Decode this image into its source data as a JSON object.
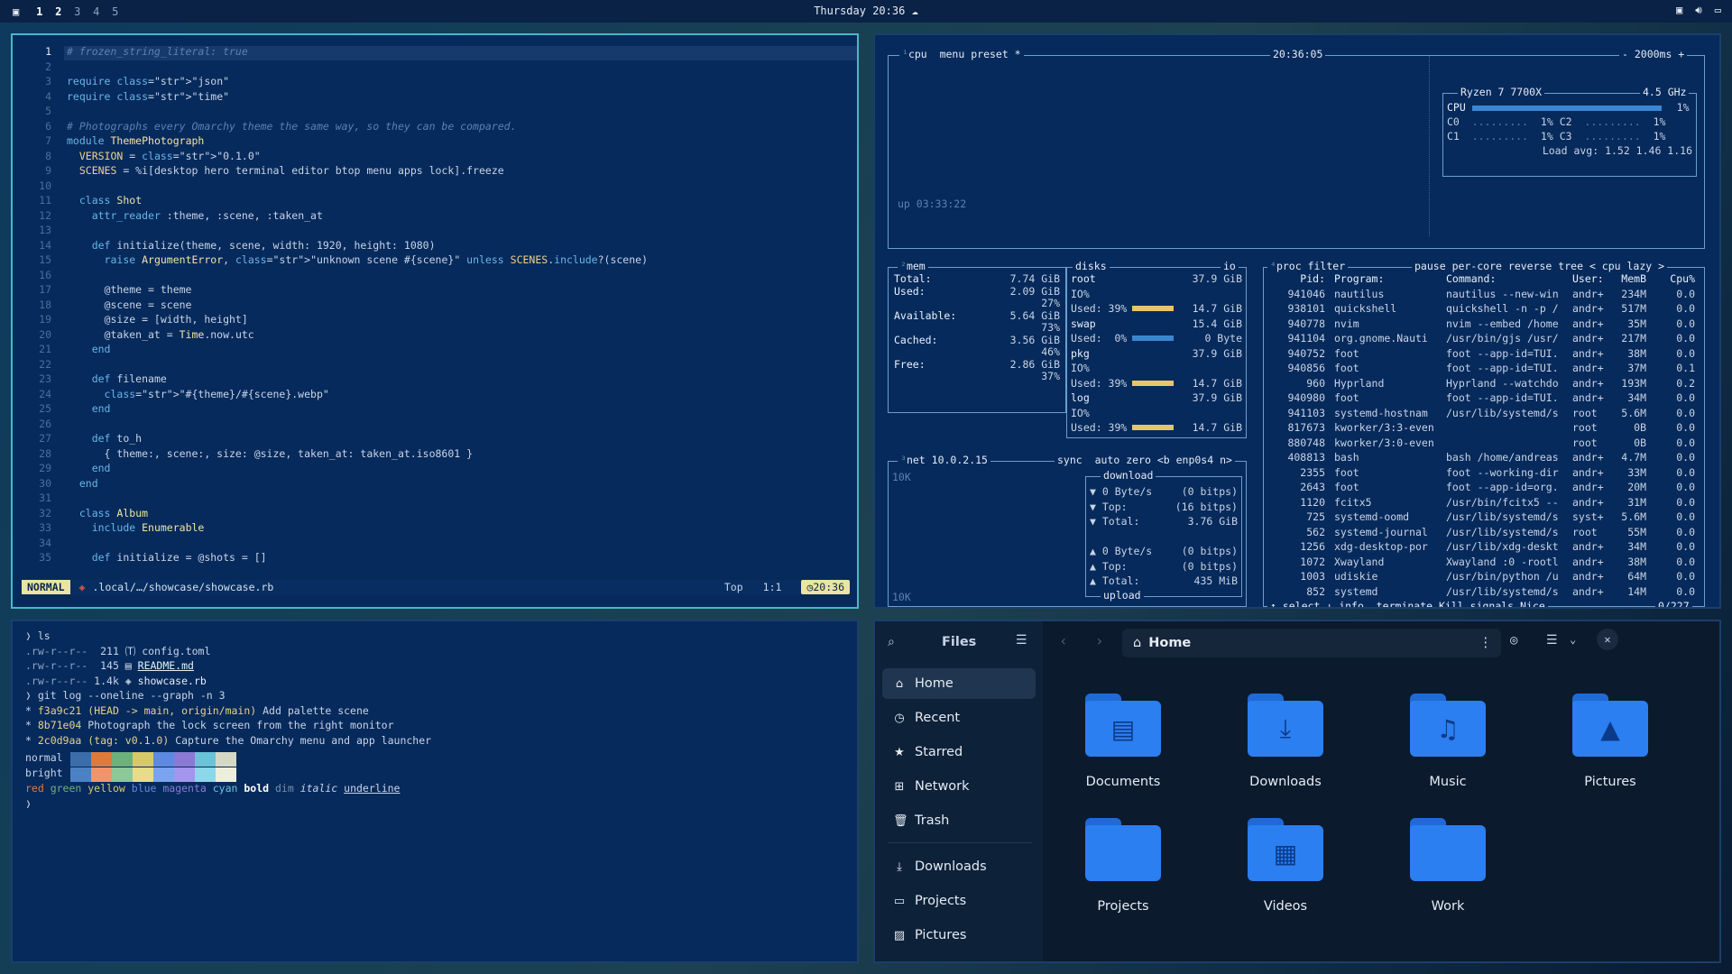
{
  "topbar": {
    "workspaces": [
      "1",
      "2",
      "3",
      "4",
      "5"
    ],
    "clock": "Thursday 20:36"
  },
  "nvim": {
    "lines": [
      {
        "n": "1",
        "t": "# frozen_string_literal: true"
      },
      {
        "n": "2",
        "t": ""
      },
      {
        "n": "3",
        "t": "require \"json\""
      },
      {
        "n": "4",
        "t": "require \"time\""
      },
      {
        "n": "5",
        "t": ""
      },
      {
        "n": "6",
        "t": "# Photographs every Omarchy theme the same way, so they can be compared."
      },
      {
        "n": "7",
        "t": "module ThemePhotograph"
      },
      {
        "n": "8",
        "t": "  VERSION = \"0.1.0\""
      },
      {
        "n": "9",
        "t": "  SCENES = %i[desktop hero terminal editor btop menu apps lock].freeze"
      },
      {
        "n": "10",
        "t": ""
      },
      {
        "n": "11",
        "t": "  class Shot"
      },
      {
        "n": "12",
        "t": "    attr_reader :theme, :scene, :taken_at"
      },
      {
        "n": "13",
        "t": ""
      },
      {
        "n": "14",
        "t": "    def initialize(theme, scene, width: 1920, height: 1080)"
      },
      {
        "n": "15",
        "t": "      raise ArgumentError, \"unknown scene #{scene}\" unless SCENES.include?(scene)"
      },
      {
        "n": "16",
        "t": ""
      },
      {
        "n": "17",
        "t": "      @theme = theme"
      },
      {
        "n": "18",
        "t": "      @scene = scene"
      },
      {
        "n": "19",
        "t": "      @size = [width, height]"
      },
      {
        "n": "20",
        "t": "      @taken_at = Time.now.utc"
      },
      {
        "n": "21",
        "t": "    end"
      },
      {
        "n": "22",
        "t": ""
      },
      {
        "n": "23",
        "t": "    def filename"
      },
      {
        "n": "24",
        "t": "      \"#{theme}/#{scene}.webp\""
      },
      {
        "n": "25",
        "t": "    end"
      },
      {
        "n": "26",
        "t": ""
      },
      {
        "n": "27",
        "t": "    def to_h"
      },
      {
        "n": "28",
        "t": "      { theme:, scene:, size: @size, taken_at: taken_at.iso8601 }"
      },
      {
        "n": "29",
        "t": "    end"
      },
      {
        "n": "30",
        "t": "  end"
      },
      {
        "n": "31",
        "t": ""
      },
      {
        "n": "32",
        "t": "  class Album"
      },
      {
        "n": "33",
        "t": "    include Enumerable"
      },
      {
        "n": "34",
        "t": ""
      },
      {
        "n": "35",
        "t": "    def initialize = @shots = []"
      }
    ],
    "status": {
      "mode": "NORMAL",
      "path": ".local/…/showcase/showcase.rb",
      "pos": "Top",
      "cursor": "1:1",
      "time": "20:36"
    }
  },
  "btop": {
    "cpu_tab": "cpu",
    "menu_tab": "menu",
    "preset_tab": "preset *",
    "time": "20:36:05",
    "interval": "- 2000ms +",
    "uptime": "up 03:33:22",
    "cpu_model": "Ryzen 7 7700X",
    "cpu_freq": "4.5 GHz",
    "cpu_rows": [
      {
        "a": "CPU",
        "av": "1%"
      },
      {
        "a": "C0",
        "av": "1%",
        "b": "C2",
        "bv": "1%"
      },
      {
        "a": "C1",
        "av": "1%",
        "b": "C3",
        "bv": "1%"
      }
    ],
    "load": "Load avg: 1.52 1.46 1.16",
    "mem": {
      "title": "mem",
      "rows": [
        {
          "l": "Total:",
          "v": "7.74 GiB"
        },
        {
          "l": "Used:",
          "v": "2.09 GiB"
        },
        {
          "l": "",
          "v": "27%"
        },
        {
          "l": "Available:",
          "v": "5.64 GiB"
        },
        {
          "l": "",
          "v": "73%"
        },
        {
          "l": "Cached:",
          "v": "3.56 GiB"
        },
        {
          "l": "",
          "v": "46%"
        },
        {
          "l": "Free:",
          "v": "2.86 GiB"
        },
        {
          "l": "",
          "v": "37%"
        }
      ]
    },
    "disks": {
      "title": "disks",
      "io": "io",
      "rows": [
        {
          "l": "root",
          "v": "37.9 GiB",
          "t": "h"
        },
        {
          "l": "IO%",
          "v": "",
          "t": "p"
        },
        {
          "l": "Used: 39%",
          "v": "14.7 GiB",
          "t": "u"
        },
        {
          "l": "swap",
          "v": "15.4 GiB",
          "t": "h"
        },
        {
          "l": "Used:  0%",
          "v": "0 Byte",
          "t": "u0"
        },
        {
          "l": "pkg",
          "v": "37.9 GiB",
          "t": "h"
        },
        {
          "l": "IO%",
          "v": "",
          "t": "p"
        },
        {
          "l": "Used: 39%",
          "v": "14.7 GiB",
          "t": "u"
        },
        {
          "l": "log",
          "v": "37.9 GiB",
          "t": "h"
        },
        {
          "l": "IO%",
          "v": "",
          "t": "p"
        },
        {
          "l": "Used: 39%",
          "v": "14.7 GiB",
          "t": "u"
        }
      ]
    },
    "net": {
      "title": "net",
      "ip": "10.0.2.15",
      "sync": "sync",
      "auto": "auto",
      "zero": "zero",
      "iface": "<b enp0s4 n>",
      "scale_top": "10K",
      "scale_bot": "10K",
      "download": "download",
      "upload": "upload",
      "rows": [
        {
          "l": "▼ 0 Byte/s",
          "v": "(0 bitps)"
        },
        {
          "l": "▼ Top:",
          "v": "(16 bitps)"
        },
        {
          "l": "▼ Total:",
          "v": "3.76 GiB"
        },
        {
          "l": "",
          "v": ""
        },
        {
          "l": "▲ 0 Byte/s",
          "v": "(0 bitps)"
        },
        {
          "l": "▲ Top:",
          "v": "(0 bitps)"
        },
        {
          "l": "▲ Total:",
          "v": "435 MiB"
        }
      ]
    },
    "proc": {
      "title": "proc",
      "filter": "filter",
      "pause": "pause",
      "percore": "per-core",
      "reverse": "reverse",
      "tree": "tree",
      "sort": "< cpu lazy >",
      "header": {
        "pid": "Pid:",
        "prog": "Program:",
        "cmd": "Command:",
        "user": "User:",
        "mem": "MemB",
        "cpu": "Cpu%"
      },
      "rows": [
        [
          "941046",
          "nautilus",
          "nautilus --new-win",
          "andr+",
          "234M",
          "0.0"
        ],
        [
          "938101",
          "quickshell",
          "quickshell -n -p /",
          "andr+",
          "517M",
          "0.0"
        ],
        [
          "940778",
          "nvim",
          "nvim --embed /home",
          "andr+",
          "35M",
          "0.0"
        ],
        [
          "941104",
          "org.gnome.Nauti",
          "/usr/bin/gjs /usr/",
          "andr+",
          "217M",
          "0.0"
        ],
        [
          "940752",
          "foot",
          "foot --app-id=TUI.",
          "andr+",
          "38M",
          "0.0"
        ],
        [
          "940856",
          "foot",
          "foot --app-id=TUI.",
          "andr+",
          "37M",
          "0.1"
        ],
        [
          "960",
          "Hyprland",
          "Hyprland --watchdo",
          "andr+",
          "193M",
          "0.2"
        ],
        [
          "940980",
          "foot",
          "foot --app-id=TUI.",
          "andr+",
          "34M",
          "0.0"
        ],
        [
          "941103",
          "systemd-hostnam",
          "/usr/lib/systemd/s",
          "root",
          "5.6M",
          "0.0"
        ],
        [
          "817673",
          "kworker/3:3-even",
          "",
          "root",
          "0B",
          "0.0"
        ],
        [
          "880748",
          "kworker/3:0-even",
          "",
          "root",
          "0B",
          "0.0"
        ],
        [
          "408813",
          "bash",
          "bash /home/andreas",
          "andr+",
          "4.7M",
          "0.0"
        ],
        [
          "2355",
          "foot",
          "foot --working-dir",
          "andr+",
          "33M",
          "0.0"
        ],
        [
          "2643",
          "foot",
          "foot --app-id=org.",
          "andr+",
          "20M",
          "0.0"
        ],
        [
          "1120",
          "fcitx5",
          "/usr/bin/fcitx5 --",
          "andr+",
          "31M",
          "0.0"
        ],
        [
          "725",
          "systemd-oomd",
          "/usr/lib/systemd/s",
          "syst+",
          "5.6M",
          "0.0"
        ],
        [
          "562",
          "systemd-journal",
          "/usr/lib/systemd/s",
          "root",
          "55M",
          "0.0"
        ],
        [
          "1256",
          "xdg-desktop-por",
          "/usr/lib/xdg-deskt",
          "andr+",
          "34M",
          "0.0"
        ],
        [
          "1072",
          "Xwayland",
          "Xwayland :0 -rootl",
          "andr+",
          "38M",
          "0.0"
        ],
        [
          "1003",
          "udiskie",
          "/usr/bin/python /u",
          "andr+",
          "64M",
          "0.0"
        ],
        [
          "852",
          "systemd",
          "/usr/lib/systemd/s",
          "andr+",
          "14M",
          "0.0"
        ]
      ],
      "footer": {
        "select": "↑ select ↓",
        "info": "info",
        "terminate": "terminate",
        "kill": "Kill",
        "signals": "signals",
        "nice": "Nice",
        "count": "0/227"
      }
    }
  },
  "terminal": {
    "lines": [
      "❭ ls",
      ".rw-r--r--  211 🄣 config.toml",
      ".rw-r--r--  145 ▤ README.md",
      ".rw-r--r-- 1.4k ◈ showcase.rb",
      "❭ git log --oneline --graph -n 3",
      "* f3a9c21 (HEAD -> main, origin/main) Add palette scene",
      "* 8b71e04 Photograph the lock screen from the right monitor",
      "* 2c0d9aa (tag: v0.1.0) Capture the Omarchy menu and app launcher"
    ],
    "normal_label": "normal",
    "bright_label": "bright",
    "normal_colors": [
      "#3b6ea8",
      "#e07a3a",
      "#6eb07c",
      "#d7c86a",
      "#5d8ae0",
      "#8a7ad6",
      "#6ac4d8",
      "#d6d8c6"
    ],
    "bright_colors": [
      "#4a82c4",
      "#f0946a",
      "#8cc898",
      "#e6dc8a",
      "#7aa4f0",
      "#a496ec",
      "#8ad8ea",
      "#eceede"
    ],
    "styles": [
      "red",
      "green",
      "yellow",
      "blue",
      "magenta",
      "cyan",
      "bold",
      "dim",
      "italic",
      "underline"
    ],
    "prompt": "❭"
  },
  "files": {
    "title": "Files",
    "location": "Home",
    "sidebar": [
      "Home",
      "Recent",
      "Starred",
      "Network",
      "Trash"
    ],
    "bookmarks": [
      "Downloads",
      "Projects",
      "Pictures"
    ],
    "folders": [
      "Documents",
      "Downloads",
      "Music",
      "Pictures",
      "Projects",
      "Videos",
      "Work"
    ]
  },
  "colors": {
    "accent": "#47b8c9",
    "folder": "#2b7ff0",
    "bg": "#072a5c",
    "yellow": "#e8e6a0"
  }
}
